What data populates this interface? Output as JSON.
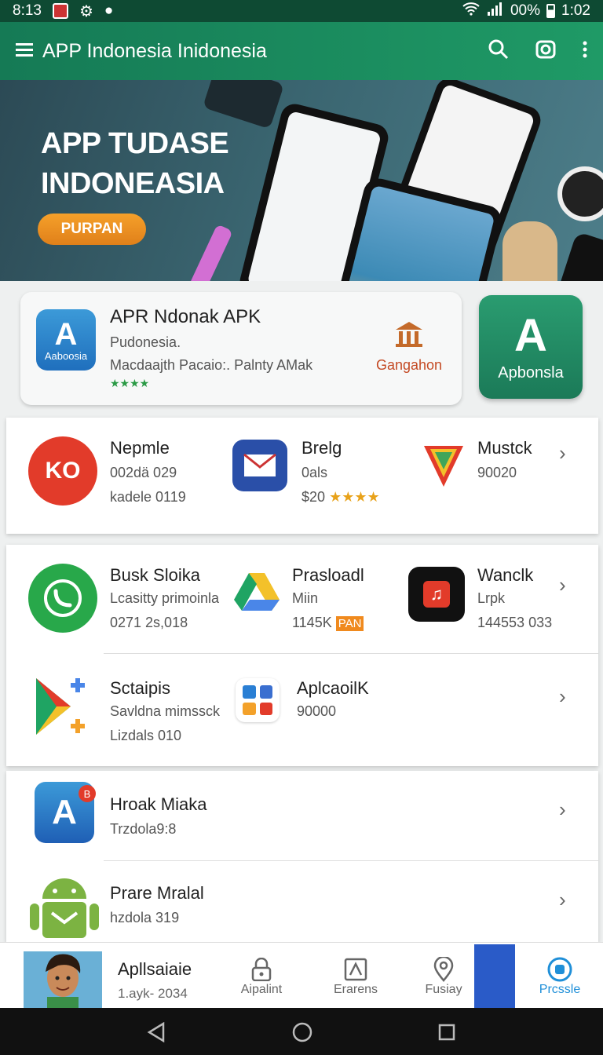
{
  "status": {
    "time": "8:13",
    "battery": "00%",
    "clock": "1:02"
  },
  "appbar": {
    "title": "APP Indonesia Inidonesia"
  },
  "hero": {
    "line1": "APP TUDASE",
    "line2": "INDONEASIA",
    "cta": "PURPAN"
  },
  "featured": {
    "icon_label": "Aaboosia",
    "name": "APR Ndonak APK",
    "sub": "Pudonesia.",
    "desc": "Macdaajth Pacaio:. Palnty AMak",
    "stars": "★★★★",
    "side_label": "Gangahon",
    "tile_label": "Apbonsla",
    "tile_letter": "A"
  },
  "row1": [
    {
      "name": "Nepmle",
      "l1": "002dä 029",
      "l2": "kadele 0119"
    },
    {
      "name": "Brelg",
      "l1": "0als",
      "l2": "$20",
      "stars": "★★★★"
    },
    {
      "name": "Mustck",
      "l1": "90020"
    }
  ],
  "row2": [
    {
      "name": "Busk Sloika",
      "l1": "Lcasitty primoinla",
      "l2": "0271 2s,018"
    },
    {
      "name": "Prasloadl",
      "l1": "Miin",
      "l2": "1145K",
      "badge": "PAN"
    },
    {
      "name": "Wanclk",
      "l1": "Lrpk",
      "l2": "144553 033"
    }
  ],
  "row3": [
    {
      "name": "Sctaipis",
      "l1": "Savldna mimssck",
      "l2": "Lizdals 010"
    },
    {
      "name": "AplcaoilK",
      "l1": "90000"
    }
  ],
  "list": [
    {
      "name": "Hroak Miaka",
      "l1": "Trzdola9:8"
    },
    {
      "name": "Prare Mralal",
      "l1": "hzdola 319"
    }
  ],
  "bottom": {
    "profile_name": "Apllsaiaie",
    "profile_sub": "1.ayk- 2034",
    "nav": [
      "Aipalint",
      "Erarens",
      "Fusiay",
      "Prcssle"
    ]
  },
  "colors": {
    "brand": "#1a8a5e",
    "accent": "#2a7fd4",
    "cta": "#f0901e"
  }
}
